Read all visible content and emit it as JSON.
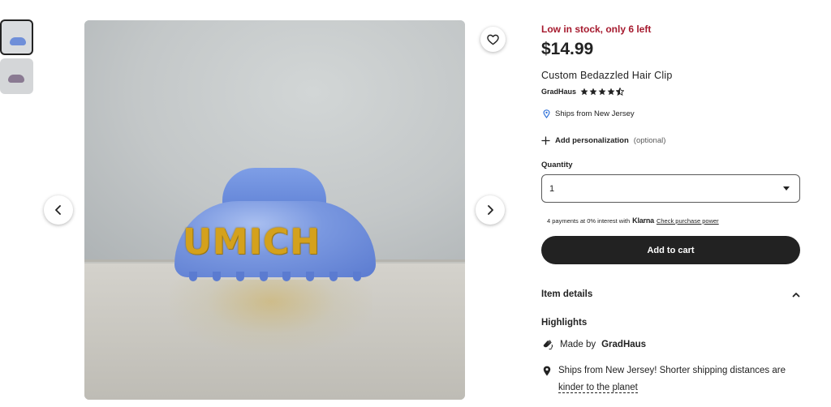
{
  "gallery": {
    "thumbnails": [
      {
        "label": "thumbnail 1",
        "selected": true
      },
      {
        "label": "thumbnail 2",
        "selected": false
      }
    ],
    "image_text": "UMICH",
    "prev_icon": "chevron-left-icon",
    "next_icon": "chevron-right-icon",
    "favorite_icon": "heart-icon"
  },
  "product": {
    "stock_notice": "Low in stock, only 6 left",
    "price": "$14.99",
    "title": "Custom Bedazzled Hair Clip",
    "shop_name": "GradHaus",
    "rating": 4.5,
    "ships_from": "Ships from New Jersey"
  },
  "personalization": {
    "label": "Add personalization",
    "optional": "(optional)"
  },
  "quantity": {
    "label": "Quantity",
    "value": "1"
  },
  "klarna": {
    "prefix": "4 payments at 0% interest with",
    "brand": "Klarna",
    "link": "Check purchase power"
  },
  "cart": {
    "button_label": "Add to cart"
  },
  "item_details": {
    "heading": "Item details",
    "highlights_heading": "Highlights",
    "made_by_prefix": "Made by",
    "made_by_shop": "GradHaus",
    "ships_text": "Ships from New Jersey! Shorter shipping distances are",
    "ships_link": "kinder to the planet"
  },
  "colors": {
    "stock_red": "#a61a2e",
    "button_dark": "#222222",
    "location_blue": "#2a6ed8"
  }
}
